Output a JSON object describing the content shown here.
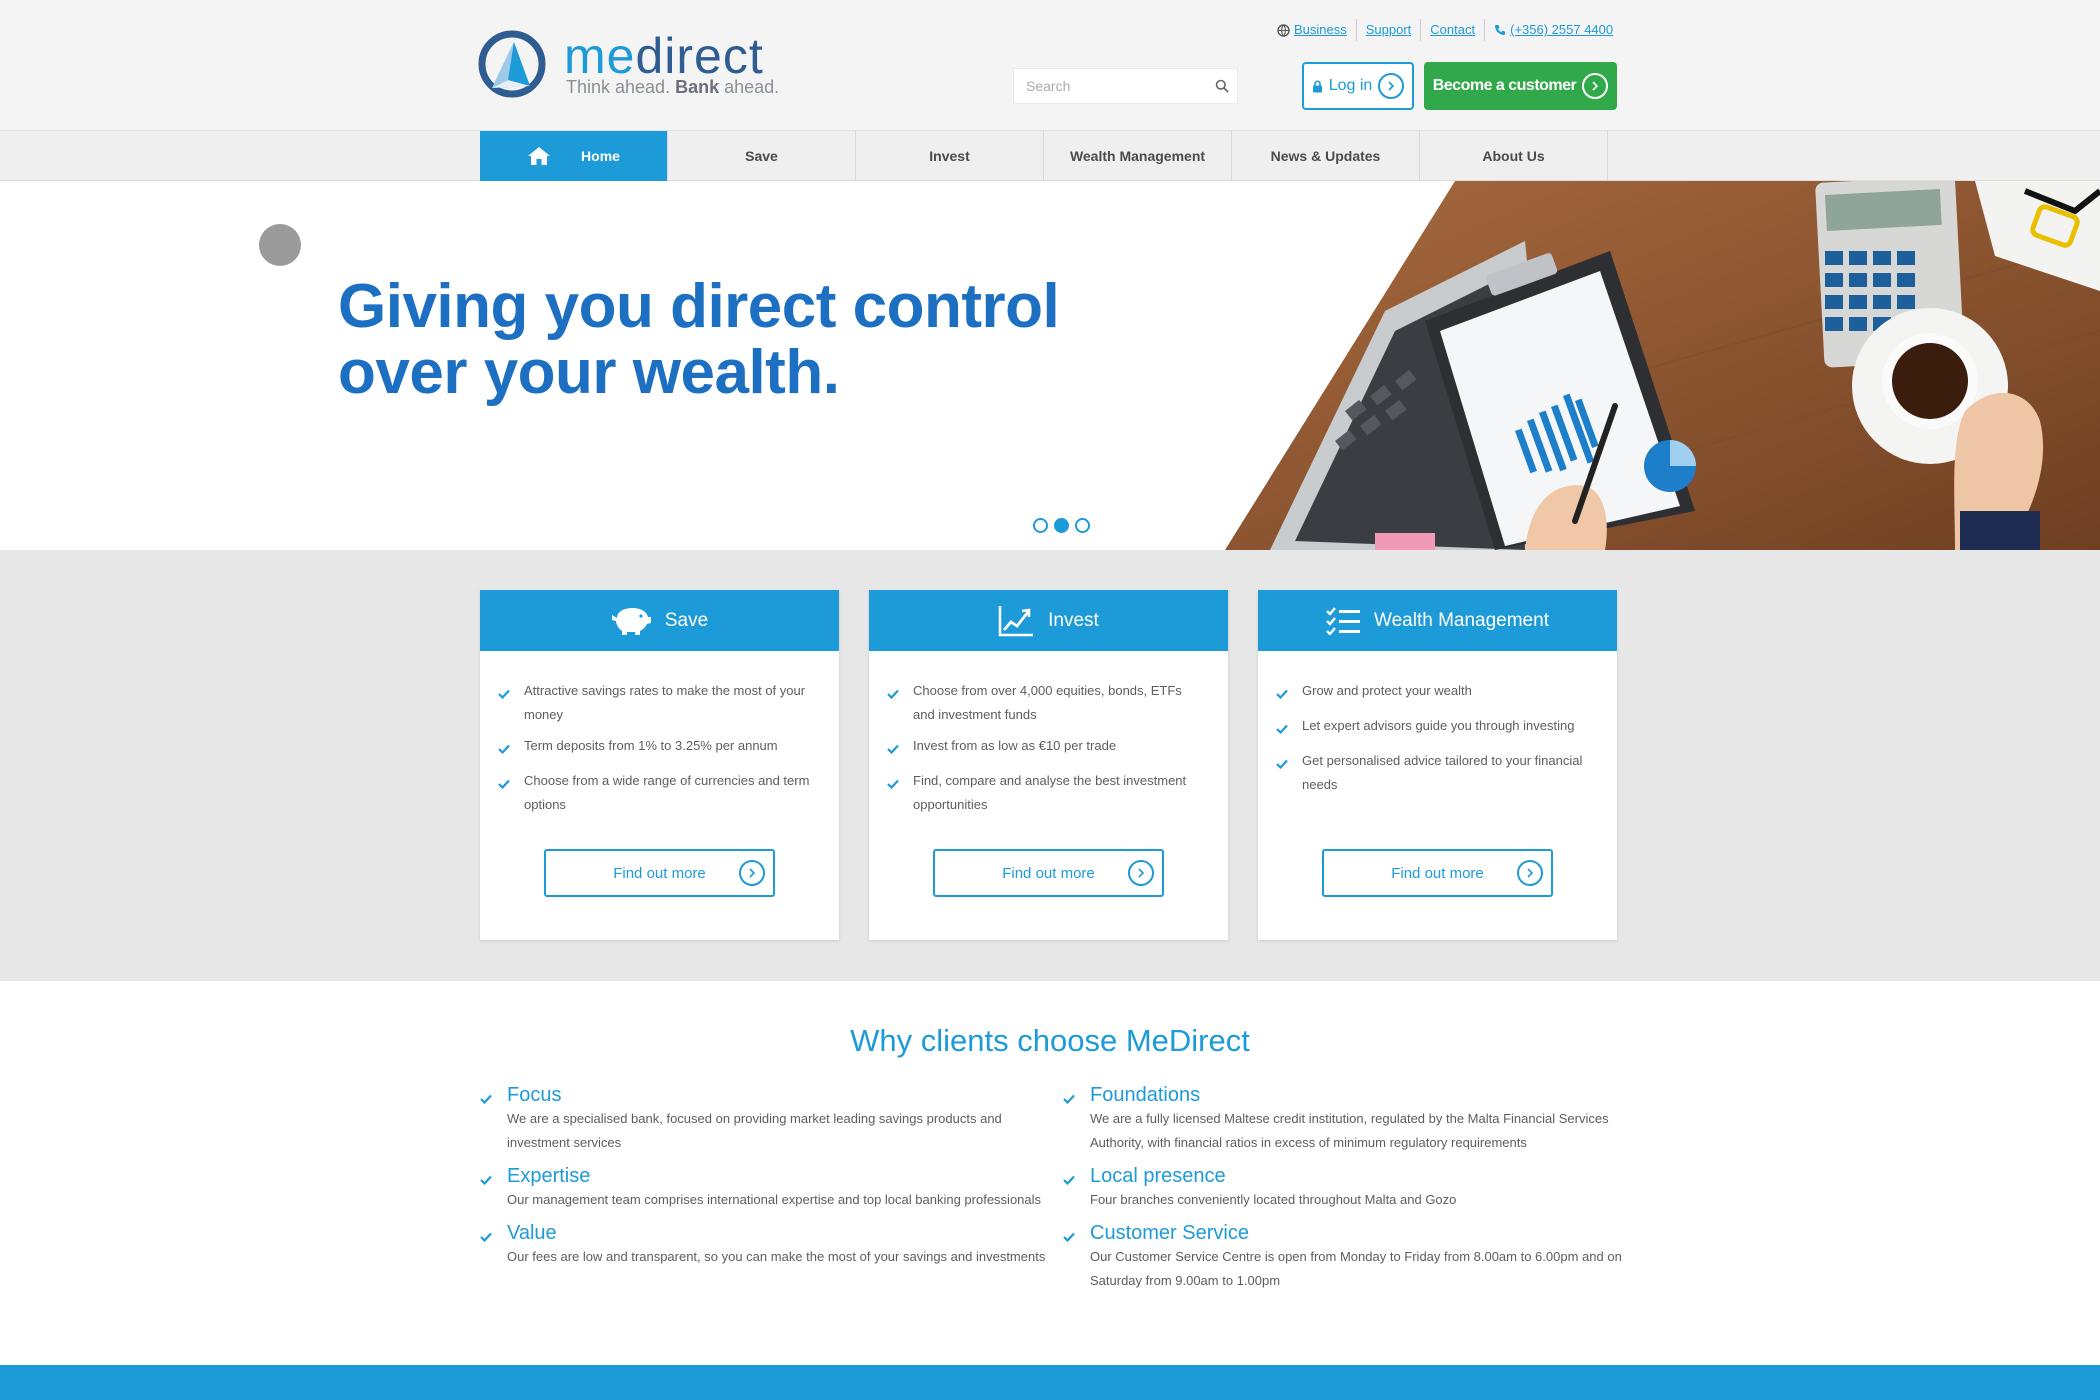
{
  "brand": {
    "name_prefix": "me",
    "name_suffix": "direct",
    "tagline_part1": "Think ahead.",
    "tagline_bold": "Bank",
    "tagline_part2": "ahead."
  },
  "toplinks": [
    {
      "label": "Business",
      "icon": "globe-icon"
    },
    {
      "label": "Support"
    },
    {
      "label": "Contact"
    },
    {
      "label": "(+356) 2557 4400",
      "icon": "phone-icon"
    }
  ],
  "search": {
    "placeholder": "Search"
  },
  "header_buttons": {
    "login": "Log in",
    "become": "Become a customer"
  },
  "nav": {
    "home": "Home",
    "save": "Save",
    "invest": "Invest",
    "wealth": "Wealth Management",
    "news": "News & Updates",
    "about": "About Us"
  },
  "hero": {
    "line1": "Giving you direct control",
    "line2": "over your wealth.",
    "slides": 3,
    "active_slide": 2
  },
  "cards": {
    "save": {
      "title": "Save",
      "icon": "piggy-bank-icon",
      "items": [
        "Attractive savings rates to make the most of your money",
        "Term deposits from 1% to 3.25% per annum",
        "Choose from a wide range of currencies and term options"
      ],
      "button": "Find out more"
    },
    "invest": {
      "title": "Invest",
      "icon": "chart-up-icon",
      "items": [
        "Choose from over 4,000 equities, bonds, ETFs and investment funds",
        "Invest from as low as €10 per trade",
        "Find, compare and analyse the best investment opportunities"
      ],
      "button": "Find out more"
    },
    "wealth": {
      "title": "Wealth Management",
      "icon": "checklist-icon",
      "items": [
        "Grow and protect your wealth",
        "Let expert advisors guide you through investing",
        "Get personalised advice tailored to your financial needs"
      ],
      "button": "Find out more"
    }
  },
  "why": {
    "title": "Why clients choose MeDirect",
    "left": [
      {
        "title": "Focus",
        "text": "We are a specialised bank, focused on providing market leading savings products and investment services"
      },
      {
        "title": "Expertise",
        "text": "Our management team comprises international expertise and top local banking professionals"
      },
      {
        "title": "Value",
        "text": "Our fees are low and transparent, so you can make the most of your savings and investments"
      }
    ],
    "right": [
      {
        "title": "Foundations",
        "text": "We are a fully licensed Maltese credit institution, regulated by the Malta Financial Services Authority, with financial ratios in excess of minimum regulatory requirements"
      },
      {
        "title": "Local presence",
        "text": "Four branches conveniently located throughout Malta and Gozo"
      },
      {
        "title": "Customer Service",
        "text": "Our Customer Service Centre is open from Monday to Friday from 8.00am to 6.00pm and on Saturday from 9.00am to 1.00pm"
      }
    ]
  },
  "colors": {
    "accent_blue": "#1d9ad8",
    "title_blue": "#1d6fc1",
    "green": "#31a84a"
  }
}
